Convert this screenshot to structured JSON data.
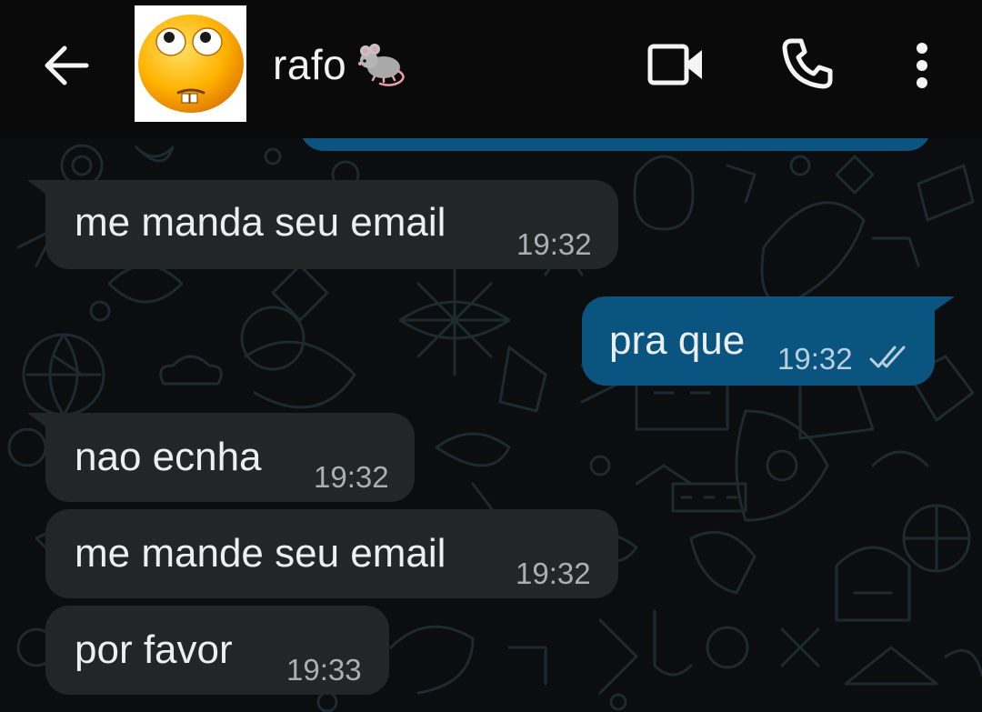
{
  "header": {
    "back_icon": "arrow-left-icon",
    "avatar_icon": "face-with-rolling-eyes-emoji",
    "contact_name": "rafo",
    "name_emoji_icon": "rat-icon",
    "video_icon": "video-camera-icon",
    "call_icon": "phone-icon",
    "menu_icon": "more-vertical-icon"
  },
  "messages": [
    {
      "direction": "incoming",
      "text": "me manda seu email",
      "time": "19:32"
    },
    {
      "direction": "outgoing",
      "text": "pra que",
      "time": "19:32",
      "status_icon": "double-check-icon"
    },
    {
      "direction": "incoming",
      "text": "nao ecnha",
      "time": "19:32"
    },
    {
      "direction": "incoming",
      "text": "me mande seu email",
      "time": "19:32"
    },
    {
      "direction": "incoming",
      "text": "por favor",
      "time": "19:33"
    }
  ],
  "colors": {
    "background": "#0b0d0e",
    "header": "#0a0a0a",
    "incoming_bubble": "#232627",
    "outgoing_bubble": "#0a5480",
    "text": "#eceff0"
  }
}
